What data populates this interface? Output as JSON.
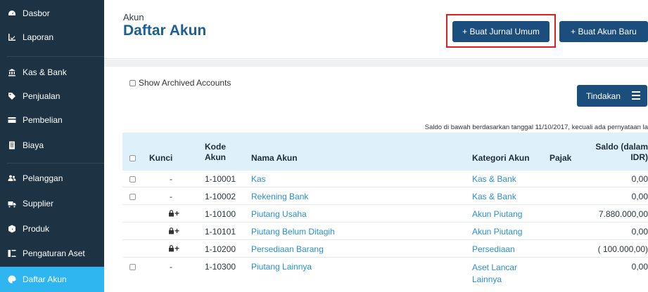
{
  "sidebar": {
    "items": [
      {
        "label": "Dasbor",
        "icon": "dashboard-icon"
      },
      {
        "label": "Laporan",
        "icon": "chart-icon"
      },
      {
        "label": "Kas & Bank",
        "icon": "bank-icon"
      },
      {
        "label": "Penjualan",
        "icon": "tag-icon"
      },
      {
        "label": "Pembelian",
        "icon": "card-icon"
      },
      {
        "label": "Biaya",
        "icon": "document-icon"
      },
      {
        "label": "Pelanggan",
        "icon": "users-icon"
      },
      {
        "label": "Supplier",
        "icon": "truck-icon"
      },
      {
        "label": "Produk",
        "icon": "box-icon"
      },
      {
        "label": "Pengaturan Aset",
        "icon": "asset-icon"
      },
      {
        "label": "Daftar Akun",
        "icon": "palette-icon"
      }
    ],
    "active_color": "#2fb6f0",
    "background_color": "#1d3344"
  },
  "header": {
    "breadcrumb": "Akun",
    "title": "Daftar Akun",
    "journal_button": "+ Buat Jurnal Umum",
    "new_account_button": "+ Buat Akun Baru"
  },
  "toolbar": {
    "show_archived": "Show Archived Accounts",
    "actions_button": "Tindakan"
  },
  "balance_note": "Saldo di bawah berdasarkan tanggal 11/10/2017, kecuali ada pernyataan la",
  "table": {
    "headers": {
      "lock": "Kunci",
      "code_line1": "Kode",
      "code_line2": "Akun",
      "name": "Nama Akun",
      "category": "Kategori Akun",
      "tax": "Pajak",
      "balance_line1": "Saldo (dalam",
      "balance_line2": "IDR)"
    },
    "rows": [
      {
        "lock": "-",
        "code": "1-10001",
        "name": "Kas",
        "category": "Kas & Bank",
        "category2": "",
        "tax": "",
        "balance": "0,00",
        "locked": false
      },
      {
        "lock": "-",
        "code": "1-10002",
        "name": "Rekening Bank",
        "category": "Kas & Bank",
        "category2": "",
        "tax": "",
        "balance": "0,00",
        "locked": false
      },
      {
        "lock": "+",
        "code": "1-10100",
        "name": "Piutang Usaha",
        "category": "Akun Piutang",
        "category2": "",
        "tax": "",
        "balance": "7.880.000,00",
        "locked": true
      },
      {
        "lock": "+",
        "code": "1-10101",
        "name": "Piutang Belum Ditagih",
        "category": "Akun Piutang",
        "category2": "",
        "tax": "",
        "balance": "0,00",
        "locked": true
      },
      {
        "lock": "+",
        "code": "1-10200",
        "name": "Persediaan Barang",
        "category": "Persediaan",
        "category2": "",
        "tax": "",
        "balance": "( 100.000,00)",
        "locked": true
      },
      {
        "lock": "-",
        "code": "1-10300",
        "name": "Piutang Lainnya",
        "category": "Aset Lancar",
        "category2": "Lainnya",
        "tax": "",
        "balance": "0,00",
        "locked": false
      }
    ]
  },
  "colors": {
    "brand_blue": "#1c4e7d",
    "title_blue": "#1b5f93",
    "link_blue": "#2a8fd0",
    "highlight_red": "#e02020",
    "table_header": "#def1fb"
  }
}
